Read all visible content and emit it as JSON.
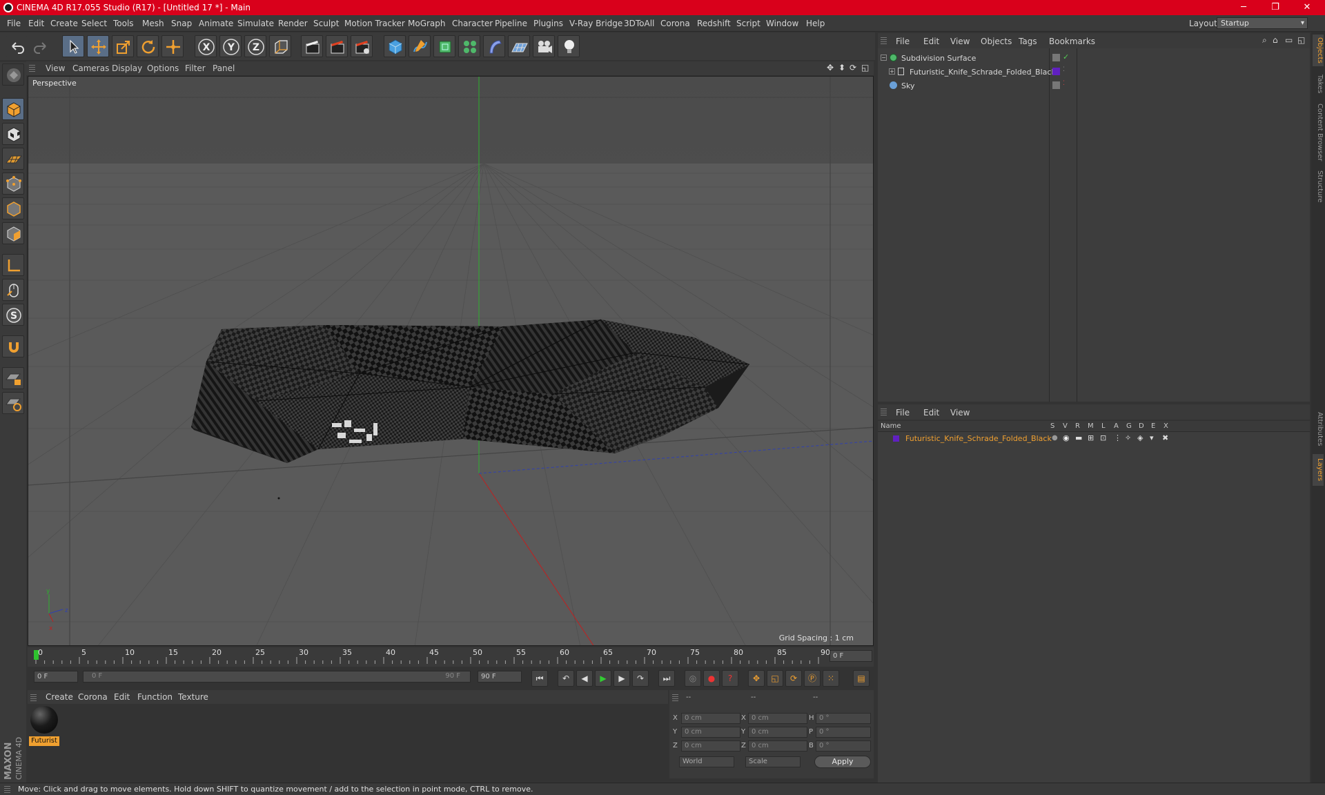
{
  "window": {
    "title": "CINEMA 4D R17.055 Studio (R17) - [Untitled 17 *] - Main",
    "controls": {
      "minimize": "─",
      "maximize": "❐",
      "close": "✕"
    }
  },
  "menubar": {
    "items": [
      "File",
      "Edit",
      "Create",
      "Select",
      "Tools",
      "Mesh",
      "Snap",
      "Animate",
      "Simulate",
      "Render",
      "Sculpt",
      "Motion Tracker",
      "MoGraph",
      "Character",
      "Pipeline",
      "Plugins",
      "V-Ray Bridge",
      "3DToAll",
      "Corona",
      "Redshift",
      "Script",
      "Window",
      "Help"
    ],
    "layout_label": "Layout:",
    "layout_value": "Startup"
  },
  "toolbar": {
    "axis_labels": [
      "X",
      "Y",
      "Z"
    ]
  },
  "viewport": {
    "menu": [
      "View",
      "Cameras",
      "Display",
      "Options",
      "Filter",
      "Panel"
    ],
    "camera_label": "Perspective",
    "grid_spacing": "Grid Spacing : 1 cm",
    "axis_gizmo": {
      "y": "y",
      "x": "x",
      "z": "z"
    }
  },
  "object_manager": {
    "menu": [
      "File",
      "Edit",
      "View",
      "Objects",
      "Tags",
      "Bookmarks"
    ],
    "objects": [
      {
        "name": "Subdivision Surface"
      },
      {
        "name": "Futuristic_Knife_Schrade_Folded_Black"
      },
      {
        "name": "Sky"
      }
    ],
    "layer_color": "#6020c0"
  },
  "layer_manager": {
    "menu": [
      "File",
      "Edit",
      "View"
    ],
    "columns": [
      "Name",
      "S",
      "V",
      "R",
      "M",
      "L",
      "A",
      "G",
      "D",
      "E",
      "X"
    ],
    "rows": [
      {
        "name": "Futuristic_Knife_Schrade_Folded_Black"
      }
    ],
    "highlight_color": "#f0a030"
  },
  "side_tabs": [
    "Objects",
    "Takes",
    "Content Browser",
    "Structure",
    "Attributes",
    "Layers"
  ],
  "timeline": {
    "ticks": [
      "0",
      "5",
      "10",
      "15",
      "20",
      "25",
      "30",
      "35",
      "40",
      "45",
      "50",
      "55",
      "60",
      "65",
      "70",
      "75",
      "80",
      "85",
      "90"
    ],
    "current_frame_field": "0 F",
    "start_field": "0 F",
    "range_start": "0 F",
    "range_end": "90 F",
    "end_field": "90 F"
  },
  "material_manager": {
    "menu": [
      "Create",
      "Corona",
      "Edit",
      "Function",
      "Texture"
    ],
    "materials": [
      {
        "name": "Futurist"
      }
    ]
  },
  "coordinates": {
    "headers": [
      "--",
      "--",
      "--"
    ],
    "rows": [
      {
        "axis": "X",
        "pos": "0 cm",
        "size_axis": "X",
        "size": "0 cm",
        "rot_axis": "H",
        "rot": "0 °"
      },
      {
        "axis": "Y",
        "pos": "0 cm",
        "size_axis": "Y",
        "size": "0 cm",
        "rot_axis": "P",
        "rot": "0 °"
      },
      {
        "axis": "Z",
        "pos": "0 cm",
        "size_axis": "Z",
        "size": "0 cm",
        "rot_axis": "B",
        "rot": "0 °"
      }
    ],
    "mode_select": "World",
    "scale_select": "Scale",
    "apply_label": "Apply"
  },
  "status": {
    "text": "Move: Click and drag to move elements. Hold down SHIFT to quantize movement / add to the selection in point mode, CTRL to remove."
  },
  "brand": {
    "line1": "MAXON",
    "line2": "CINEMA 4D"
  }
}
